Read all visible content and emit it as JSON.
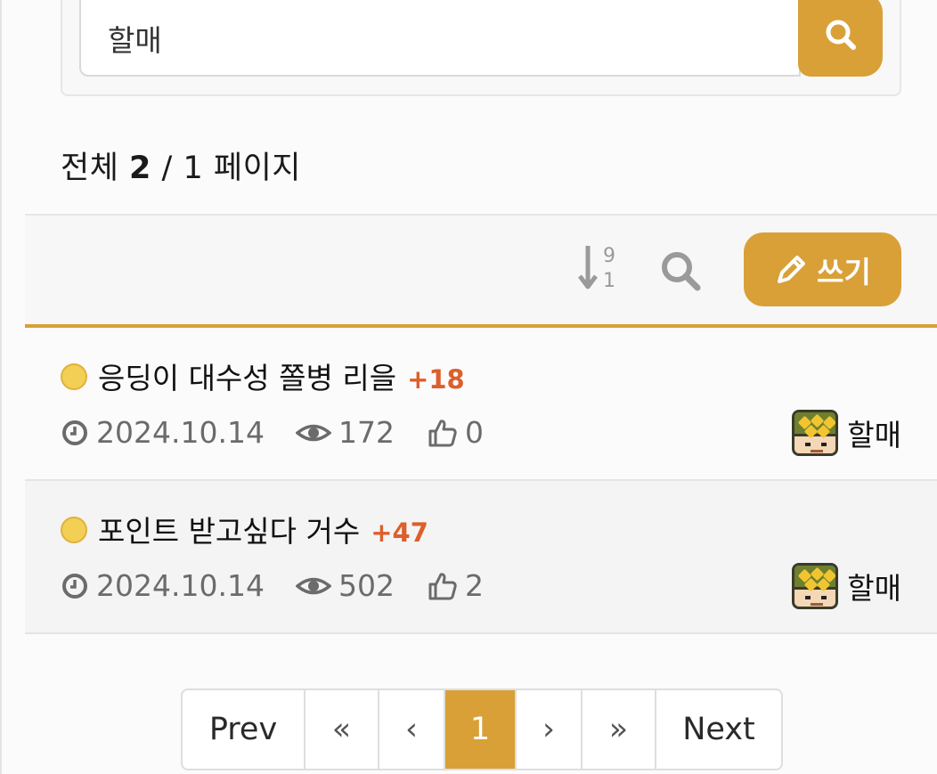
{
  "search": {
    "value": "할매",
    "button_icon": "search-icon"
  },
  "summary": {
    "prefix": "전체",
    "total": "2",
    "separator": "/",
    "pages": "1",
    "suffix": "페이지"
  },
  "toolbar": {
    "sort_icon": "sort-numeric-desc-icon",
    "search_icon": "search-icon",
    "write_label": "쓰기",
    "write_icon": "pencil-icon"
  },
  "posts": [
    {
      "title": "응딩이 대수성 쫄병 리을",
      "comments": "+18",
      "date": "2024.10.14",
      "views": "172",
      "likes": "0",
      "author": "할매"
    },
    {
      "title": "포인트 받고싶다 거수",
      "comments": "+47",
      "date": "2024.10.14",
      "views": "502",
      "likes": "2",
      "author": "할매"
    }
  ],
  "pagination": {
    "prev": "Prev",
    "first": "«",
    "back": "‹",
    "current": "1",
    "forward": "›",
    "last": "»",
    "next": "Next"
  },
  "colors": {
    "accent": "#d9a037",
    "comment_count": "#dc5f2c"
  }
}
